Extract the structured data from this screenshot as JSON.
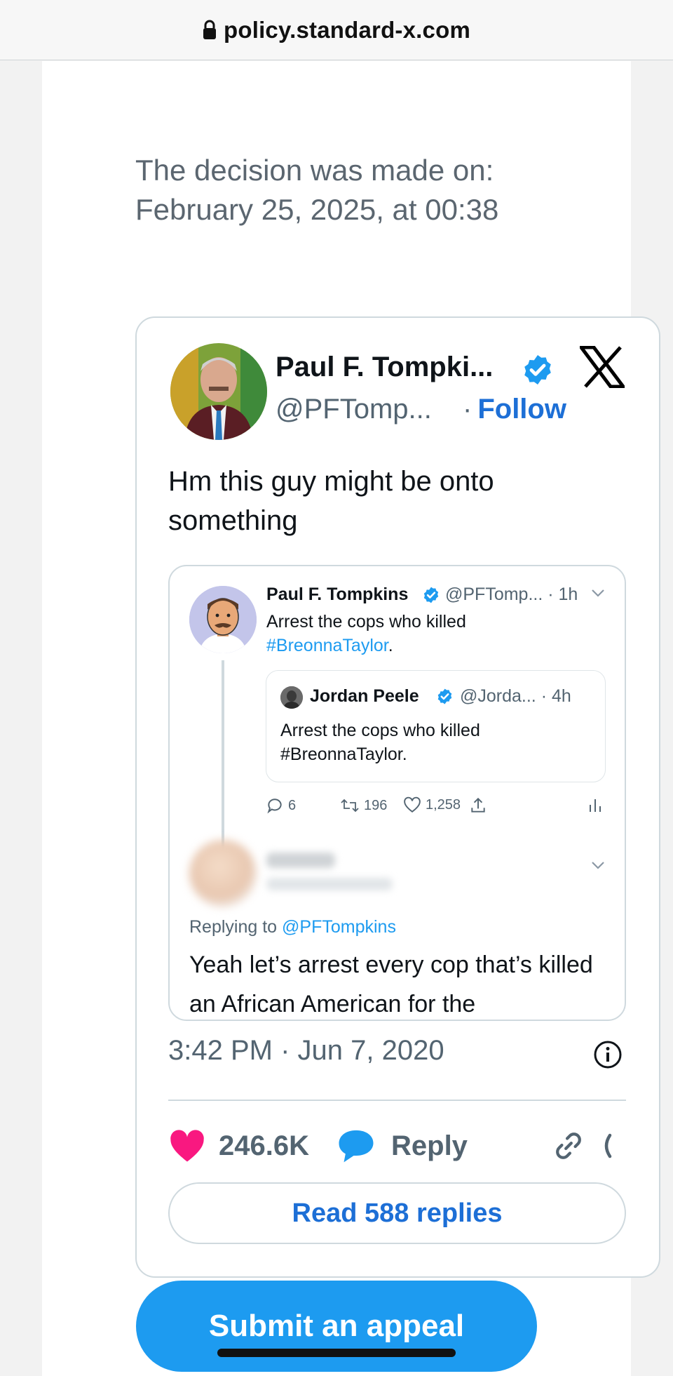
{
  "browser": {
    "url": "policy.standard-x.com"
  },
  "decision": {
    "line1": "The decision was made on:",
    "line2": "February 25, 2025, at 00:38"
  },
  "tweet": {
    "author_name": "Paul F. Tompki...",
    "handle": "@PFTomp...",
    "follow_sep": "·",
    "follow_label": "Follow",
    "text": "Hm this guy might be onto something",
    "timestamp": "3:42 PM · Jun 7, 2020",
    "likes": "246.6K",
    "reply_label": "Reply",
    "read_replies": "Read 588 replies",
    "colors": {
      "like": "#f91880",
      "reply": "#1d9bf0",
      "link": "#1d6fd6"
    }
  },
  "embed": {
    "author_name": "Paul F. Tompkins",
    "author_handle_time": "@PFTomp... · 1h",
    "text_plain": "Arrest the cops who killed",
    "text_tag": "#BreonnaTaylor",
    "text_end": ".",
    "quote": {
      "name": "Jordan Peele",
      "handle_time": "@Jorda... · 4h",
      "text": "Arrest the cops who killed #BreonnaTaylor."
    },
    "stats": {
      "replies": "6",
      "retweets": "196",
      "likes": "1,258"
    },
    "reply": {
      "replying_prefix": "Replying to",
      "replying_mention": "@PFTompkins",
      "text": "Yeah let’s arrest every cop that’s killed an African American for the"
    }
  },
  "appeal": {
    "label": "Submit an appeal"
  }
}
